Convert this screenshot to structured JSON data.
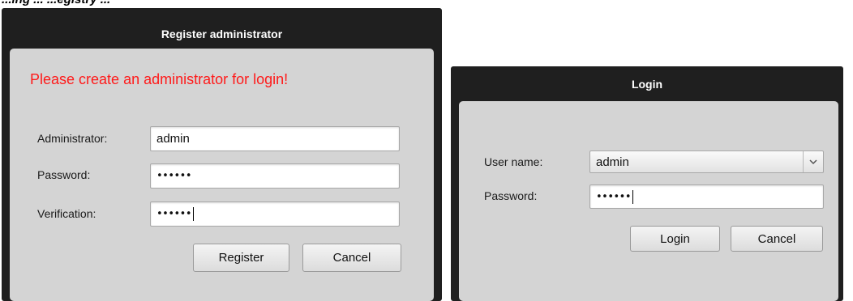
{
  "caption_fragment": "...ing ... ...egistry ...",
  "register_dialog": {
    "title": "Register administrator",
    "headline": "Please create an administrator for login!",
    "headline_color": "#ff1a1a",
    "fields": {
      "administrator_label": "Administrator:",
      "administrator_value": "admin",
      "password_label": "Password:",
      "password_value": "••••••",
      "verification_label": "Verification:",
      "verification_value": "••••••"
    },
    "buttons": {
      "register": "Register",
      "cancel": "Cancel"
    }
  },
  "login_dialog": {
    "title": "Login",
    "fields": {
      "username_label": "User name:",
      "username_value": "admin",
      "username_dropdown_icon": "chevron-down-icon",
      "password_label": "Password:",
      "password_value": "••••••"
    },
    "buttons": {
      "login": "Login",
      "cancel": "Cancel"
    }
  },
  "colors": {
    "dialog_frame": "#1f1f1f",
    "dialog_body": "#d4d4d4",
    "headline": "#ff1a1a"
  }
}
